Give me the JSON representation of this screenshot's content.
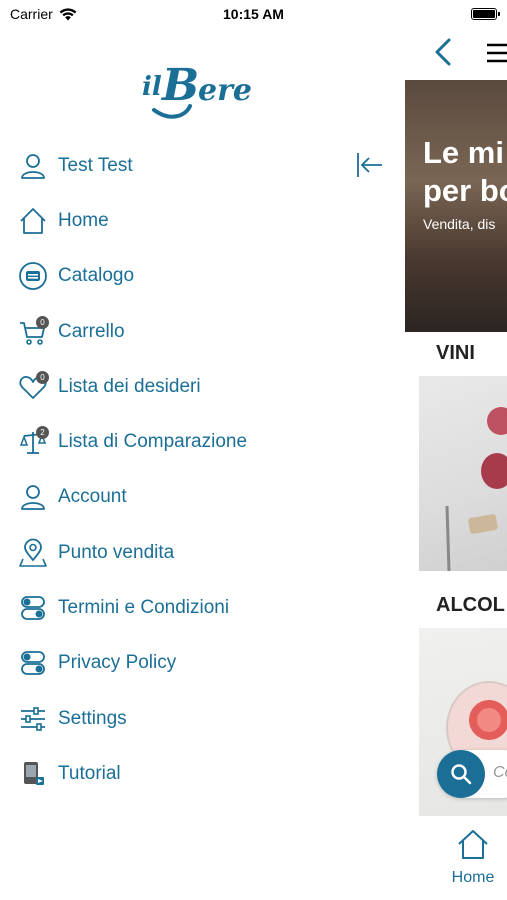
{
  "status_bar": {
    "carrier": "Carrier",
    "time": "10:15 AM"
  },
  "brand": {
    "logo_text_small": "il",
    "logo_text_big": "Bere",
    "color": "#1b6f97"
  },
  "menu": {
    "items": [
      {
        "label": "Test Test",
        "icon": "user-icon"
      },
      {
        "label": "Home",
        "icon": "home-icon"
      },
      {
        "label": "Catalogo",
        "icon": "catalog-icon"
      },
      {
        "label": "Carrello",
        "icon": "cart-icon",
        "badge": "0"
      },
      {
        "label": "Lista dei desideri",
        "icon": "heart-icon",
        "badge": "0"
      },
      {
        "label": "Lista di Comparazione",
        "icon": "scale-icon",
        "badge": "2"
      },
      {
        "label": "Account",
        "icon": "account-icon"
      },
      {
        "label": "Punto vendita",
        "icon": "location-icon"
      },
      {
        "label": "Termini e Condizioni",
        "icon": "toggles-icon"
      },
      {
        "label": "Privacy Policy",
        "icon": "toggles-icon"
      },
      {
        "label": "Settings",
        "icon": "sliders-icon"
      },
      {
        "label": "Tutorial",
        "icon": "tutorial-icon"
      }
    ]
  },
  "main": {
    "hero": {
      "title_line1": "Le mi",
      "title_line2": "per bo",
      "subtitle": "Vendita, dis"
    },
    "categories": [
      {
        "title": "VINI"
      },
      {
        "title": "ALCOL"
      }
    ],
    "search": {
      "placeholder": "Co"
    },
    "tabbar": {
      "home_label": "Home"
    }
  }
}
